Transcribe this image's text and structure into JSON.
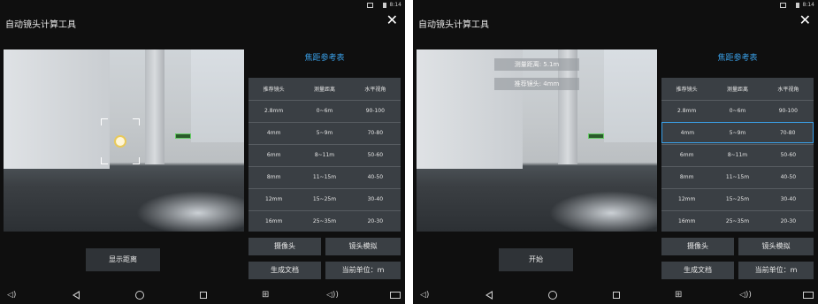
{
  "status": {
    "time": "8:14"
  },
  "app": {
    "title": "自动镜头计算工具"
  },
  "reference": {
    "title": "焦距参考表",
    "headers": [
      "推荐镜头",
      "测量距离",
      "水平视角"
    ],
    "rows": [
      [
        "2.8mm",
        "0~6m",
        "90-100"
      ],
      [
        "4mm",
        "5~9m",
        "70-80"
      ],
      [
        "6mm",
        "8~11m",
        "50-60"
      ],
      [
        "8mm",
        "11~15m",
        "40-50"
      ],
      [
        "12mm",
        "15~25m",
        "30-40"
      ],
      [
        "16mm",
        "25~35m",
        "20-30"
      ]
    ]
  },
  "left_screen": {
    "main_button": "显示距离"
  },
  "right_screen": {
    "main_button": "开始",
    "measured_distance": "测量距离: 5.1m",
    "recommended_lens": "推荐镜头: 4mm",
    "selected_row": 1
  },
  "controls": {
    "camera": "摄像头",
    "lens_sim": "镜头模拟",
    "generate_doc": "生成文档",
    "unit": "当前单位：m"
  }
}
